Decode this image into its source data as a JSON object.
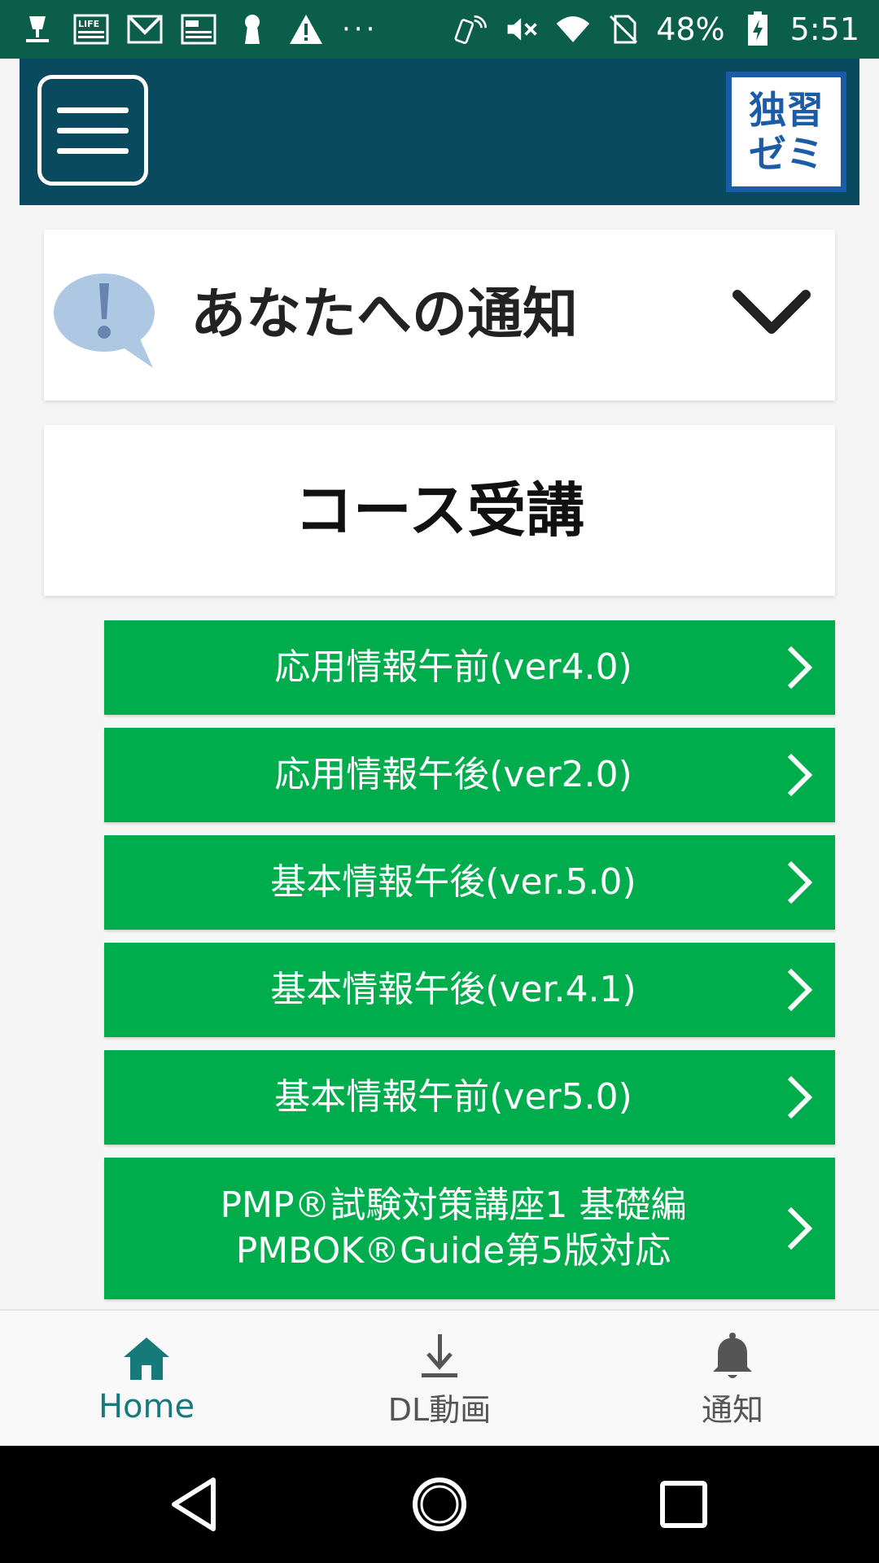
{
  "status_bar": {
    "battery": "48%",
    "time": "5:51",
    "overflow": "···",
    "life_badge": "LIFE"
  },
  "header": {
    "logo_line1": "独習",
    "logo_line2": "ゼミ"
  },
  "notifications": {
    "title": "あなたへの通知"
  },
  "course": {
    "title": "コース受講",
    "items": [
      {
        "label": "応用情報午前(ver4.0)"
      },
      {
        "label": "応用情報午後(ver2.0)"
      },
      {
        "label": "基本情報午後(ver.5.0)"
      },
      {
        "label": "基本情報午後(ver.4.1)"
      },
      {
        "label": "基本情報午前(ver5.0)"
      },
      {
        "label": "PMP®試験対策講座1 基礎編\nPMBOK®Guide第5版対応"
      }
    ]
  },
  "bottom_nav": {
    "home": "Home",
    "downloads": "DL動画",
    "notifications": "通知"
  },
  "colors": {
    "status_bar": "#0b5e4a",
    "header": "#0a4a5e",
    "course_button": "#00ad4d",
    "nav_active": "#177a7a"
  }
}
